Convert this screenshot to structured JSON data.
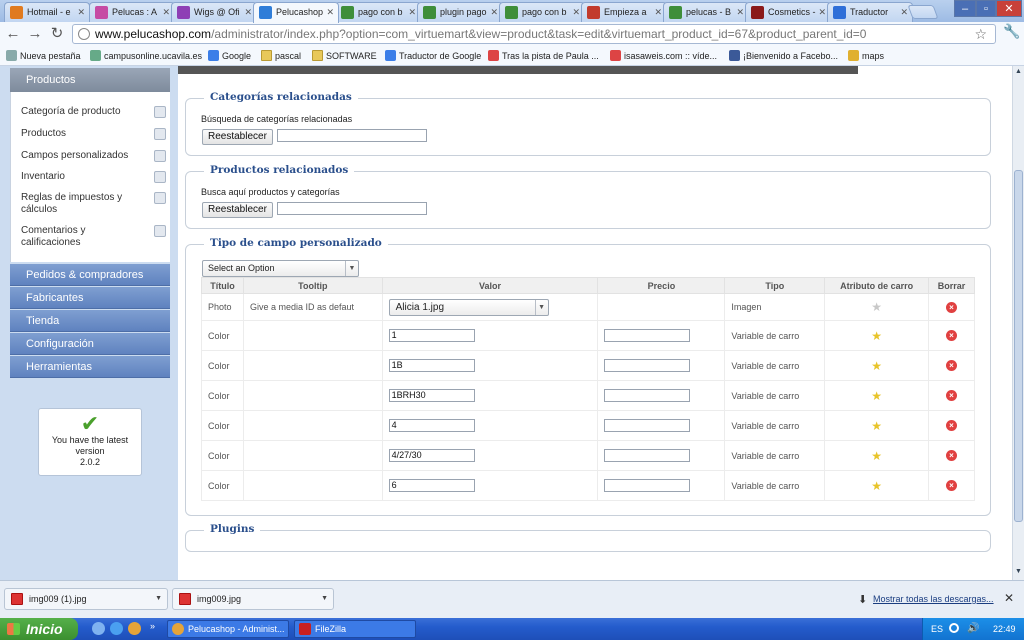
{
  "browser": {
    "tabs": [
      {
        "label": "Hotmail - e",
        "color": "#e07a1f"
      },
      {
        "label": "Pelucas : A",
        "color": "#c64ba4"
      },
      {
        "label": "Wigs @ Ofi",
        "color": "#8e3fb5"
      },
      {
        "label": "Pelucashop",
        "color": "#2f7dd8",
        "active": true
      },
      {
        "label": "pago con b",
        "color": "#3f8e3a"
      },
      {
        "label": "plugin pago",
        "color": "#3f8e3a"
      },
      {
        "label": "pago con b",
        "color": "#3f8e3a"
      },
      {
        "label": "Empieza a",
        "color": "#c23b2d"
      },
      {
        "label": "pelucas - B",
        "color": "#3f8e3a"
      },
      {
        "label": "Cosmetics -",
        "color": "#8b1a1a"
      },
      {
        "label": "Traductor",
        "color": "#2f6fd8"
      }
    ],
    "url_host": "www.pelucashop.com",
    "url_path": "/administrator/index.php?option=com_virtuemart&view=product&task=edit&virtuemart_product_id=67&product_parent_id=0",
    "bookmarks": [
      {
        "label": "Nueva pestaña",
        "icon": "page-icon"
      },
      {
        "label": "campusonline.ucavila.es",
        "icon": "globe-icon"
      },
      {
        "label": "Google",
        "icon": "google-icon"
      },
      {
        "label": "pascal",
        "icon": "folder-icon"
      },
      {
        "label": "SOFTWARE",
        "icon": "folder-icon"
      },
      {
        "label": "Traductor de Google",
        "icon": "translate-icon"
      },
      {
        "label": "Tras la pista de Paula ...",
        "icon": "site-icon"
      },
      {
        "label": "isasaweis.com :: víde...",
        "icon": "site-icon"
      },
      {
        "label": "¡Bienvenido a Facebo...",
        "icon": "facebook-icon"
      },
      {
        "label": "maps",
        "icon": "maps-icon"
      }
    ]
  },
  "sidebar": {
    "header": "Productos",
    "sub_items": [
      {
        "label": "Categoría de producto"
      },
      {
        "label": "Productos"
      },
      {
        "label": "Campos personalizados"
      },
      {
        "label": "Inventario"
      },
      {
        "label": "Reglas de impuestos y cálculos"
      },
      {
        "label": "Comentarios y calificaciones"
      }
    ],
    "sections": [
      {
        "label": "Pedidos & compradores"
      },
      {
        "label": "Fabricantes"
      },
      {
        "label": "Tienda"
      },
      {
        "label": "Configuración"
      },
      {
        "label": "Herramientas"
      }
    ],
    "version_box": {
      "text": "You have the latest version",
      "version": "2.0.2"
    }
  },
  "related_categories": {
    "legend": "Categorías relacionadas",
    "label": "Búsqueda de categorías relacionadas",
    "reset_label": "Reestablecer",
    "value": ""
  },
  "related_products": {
    "legend": "Productos relacionados",
    "label": "Busca aquí productos y categorías",
    "reset_label": "Reestablecer",
    "value": ""
  },
  "custom_field": {
    "legend": "Tipo de campo personalizado",
    "select_value": "Select an Option",
    "columns": [
      "Título",
      "Tooltip",
      "Valor",
      "Precio",
      "Tipo",
      "Atributo de carro",
      "Borrar"
    ],
    "rows": [
      {
        "titulo": "Photo",
        "tooltip": "Give a media ID as defaut",
        "valor": "Alicia 1.jpg",
        "valor_kind": "select",
        "precio": "",
        "tipo": "Imagen",
        "cart_attribute": false
      },
      {
        "titulo": "Color",
        "tooltip": "",
        "valor": "1",
        "valor_kind": "input",
        "precio": "",
        "tipo": "Variable de carro",
        "cart_attribute": true
      },
      {
        "titulo": "Color",
        "tooltip": "",
        "valor": "1B",
        "valor_kind": "input",
        "precio": "",
        "tipo": "Variable de carro",
        "cart_attribute": true
      },
      {
        "titulo": "Color",
        "tooltip": "",
        "valor": "1BRH30",
        "valor_kind": "input",
        "precio": "",
        "tipo": "Variable de carro",
        "cart_attribute": true
      },
      {
        "titulo": "Color",
        "tooltip": "",
        "valor": "4",
        "valor_kind": "input",
        "precio": "",
        "tipo": "Variable de carro",
        "cart_attribute": true
      },
      {
        "titulo": "Color",
        "tooltip": "",
        "valor": "4/27/30",
        "valor_kind": "input",
        "precio": "",
        "tipo": "Variable de carro",
        "cart_attribute": true
      },
      {
        "titulo": "Color",
        "tooltip": "",
        "valor": "6",
        "valor_kind": "input",
        "precio": "",
        "tipo": "Variable de carro",
        "cart_attribute": true
      }
    ]
  },
  "plugins": {
    "legend": "Plugins"
  },
  "downloads": {
    "items": [
      {
        "label": "img009 (1).jpg"
      },
      {
        "label": "img009.jpg"
      }
    ],
    "show_all": "Mostrar todas las descargas..."
  },
  "taskbar": {
    "start_label": "Inicio",
    "tasks": [
      {
        "label": "Pelucashop - Administ...",
        "icon": "chrome-icon"
      },
      {
        "label": "FileZilla",
        "icon": "filezilla-icon"
      }
    ],
    "language": "ES",
    "clock": "22:49"
  },
  "colors": {
    "accent": "#2a4f8c",
    "sidebar_section": "#6b8cc7",
    "taskbar": "#245ccc"
  }
}
